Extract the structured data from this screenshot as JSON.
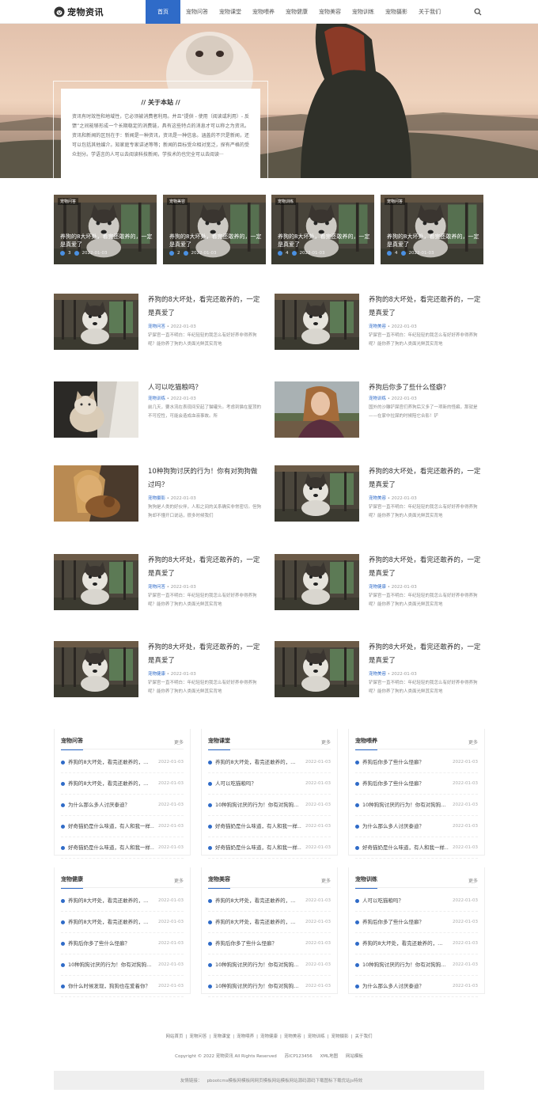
{
  "header": {
    "logo_text": "宠物资讯",
    "nav": [
      "首页",
      "宠物问答",
      "宠物课堂",
      "宠物喂养",
      "宠物健康",
      "宠物美容",
      "宠物训练",
      "宠物摄影",
      "关于我们"
    ],
    "active_index": 0
  },
  "hero": {
    "about_title": "// 关于本站 //",
    "about_text": "资讯有时效性和地域性，它必须被消费者利用。并且“提供 - 使用（阅读或利用）- 反馈”之间能够形成一个长期稳定的消费链，具有这些特点的消息才可以称之为资讯。资讯和新闻的区别在于：新闻是一种资讯，资讯是一种信息。涵盖的不只是新闻，还可以包括其他媒介。知家庭专家讲述等等；新闻的目标受众相对宽泛，探有严格的受众划分。学语言的人可以去阅读科技新闻，学技术的也完全可以去阅读···"
  },
  "featured": [
    {
      "tag": "宠物问答",
      "title": "养狗的8大坏处，看完还敢养的，一定是真爱了",
      "views": "3",
      "date": "2022-01-03"
    },
    {
      "tag": "宠物美容",
      "title": "养狗的8大坏处，看完还敢养的，一定是真爱了",
      "views": "2",
      "date": "2022-01-03"
    },
    {
      "tag": "宠物训练",
      "title": "养狗的8大坏处，看完还敢养的，一定是真爱了",
      "views": "4",
      "date": "2022-01-03"
    },
    {
      "tag": "宠物问答",
      "title": "养狗的8大坏处，看完还敢养的，一定是真爱了",
      "views": "4",
      "date": "2022-01-03"
    }
  ],
  "articles": [
    {
      "title": "养狗的8大坏处，看完还敢养的，一定是真爱了",
      "cat": "宠物问答",
      "date": "2022-01-03",
      "excerpt": "铲屎官一直不明白：年纪轻轻的我怎么有好好养非得养狗呢？能你养了狗的人类面光鲜其实背地",
      "img": "husky"
    },
    {
      "title": "养狗的8大坏处，看完还敢养的，一定是真爱了",
      "cat": "宠物美容",
      "date": "2022-01-03",
      "excerpt": "铲屎官一直不明白：年纪轻轻的我怎么有好好养非得养狗呢？能你养了狗的人类面光鲜其实背地",
      "img": "husky"
    },
    {
      "title": "人可以吃猫粮吗？",
      "cat": "宠物训练",
      "date": "2022-01-03",
      "excerpt": "前几天，要水流在表现间安起了猫罐头。考虑到猫在屋顶的不可控性，可能会造成血液事故。所",
      "img": "cat"
    },
    {
      "title": "养狗后你多了些什么怪癖？",
      "cat": "宠物训练",
      "date": "2022-01-03",
      "excerpt": "国外的沙雕铲屎官们养狗后又多了一项新的怪癖，那就是——在家中拉屎的时候陪它合影！铲",
      "img": "woman"
    },
    {
      "title": "10种狗狗讨厌的行为！你有对狗狗做过吗？",
      "cat": "宠物摄影",
      "date": "2022-01-03",
      "excerpt": "狗狗是人类的好伙伴，人和之间的关系确实非常密切。但狗狗却不懂开口说话，很多时候我们",
      "img": "girl"
    },
    {
      "title": "养狗的8大坏处，看完还敢养的，一定是真爱了",
      "cat": "宠物美容",
      "date": "2022-01-03",
      "excerpt": "铲屎官一直不明白：年纪轻轻的我怎么有好好养非得养狗呢？能你养了狗的人类面光鲜其实背地",
      "img": "husky"
    },
    {
      "title": "养狗的8大坏处，看完还敢养的，一定是真爱了",
      "cat": "宠物问答",
      "date": "2022-01-03",
      "excerpt": "铲屎官一直不明白：年纪轻轻的我怎么有好好养非得养狗呢？能你养了狗的人类面光鲜其实背地",
      "img": "husky"
    },
    {
      "title": "养狗的8大坏处，看完还敢养的，一定是真爱了",
      "cat": "宠物健康",
      "date": "2022-01-03",
      "excerpt": "铲屎官一直不明白：年纪轻轻的我怎么有好好养非得养狗呢？能你养了狗的人类面光鲜其实背地",
      "img": "husky"
    },
    {
      "title": "养狗的8大坏处，看完还敢养的，一定是真爱了",
      "cat": "宠物健康",
      "date": "2022-01-03",
      "excerpt": "铲屎官一直不明白：年纪轻轻的我怎么有好好养非得养狗呢？能你养了狗的人类面光鲜其实背地",
      "img": "husky"
    },
    {
      "title": "养狗的8大坏处，看完还敢养的，一定是真爱了",
      "cat": "宠物美容",
      "date": "2022-01-03",
      "excerpt": "铲屎官一直不明白：年纪轻轻的我怎么有好好养非得养狗呢？能你养了狗的人类面光鲜其实背地",
      "img": "husky"
    }
  ],
  "boxes": [
    {
      "title": "宠物问答",
      "more": "更多",
      "items": [
        {
          "t": "养狗的8大坏处，看完还敢养的，...",
          "d": "2022-01-03"
        },
        {
          "t": "养狗的8大坏处，看完还敢养的，...",
          "d": "2022-01-03"
        },
        {
          "t": "为什么那么多人讨厌泰迪？",
          "d": "2022-01-03"
        },
        {
          "t": "好奇猫奶是什么味道，有人和我一样...",
          "d": "2022-01-03"
        },
        {
          "t": "好奇猫奶是什么味道，有人和我一样...",
          "d": "2022-01-03"
        }
      ]
    },
    {
      "title": "宠物课堂",
      "more": "更多",
      "items": [
        {
          "t": "养狗的8大坏处，看完还敢养的，...",
          "d": "2022-01-03"
        },
        {
          "t": "人可以吃猫粮吗？",
          "d": "2022-01-03"
        },
        {
          "t": "10种狗狗讨厌的行为！你有对狗狗...",
          "d": "2022-01-03"
        },
        {
          "t": "好奇猫奶是什么味道，有人和我一样...",
          "d": "2022-01-03"
        },
        {
          "t": "好奇猫奶是什么味道，有人和我一样...",
          "d": "2022-01-03"
        }
      ]
    },
    {
      "title": "宠物喂养",
      "more": "更多",
      "items": [
        {
          "t": "养狗后你多了些什么怪癖？",
          "d": "2022-01-03"
        },
        {
          "t": "养狗后你多了些什么怪癖？",
          "d": "2022-01-03"
        },
        {
          "t": "10种狗狗讨厌的行为！你有对狗狗...",
          "d": "2022-01-03"
        },
        {
          "t": "为什么那么多人讨厌泰迪？",
          "d": "2022-01-03"
        },
        {
          "t": "好奇猫奶是什么味道，有人和我一样...",
          "d": "2022-01-03"
        }
      ]
    },
    {
      "title": "宠物健康",
      "more": "更多",
      "items": [
        {
          "t": "养狗的8大坏处，看完还敢养的，...",
          "d": "2022-01-03"
        },
        {
          "t": "养狗的8大坏处，看完还敢养的，...",
          "d": "2022-01-03"
        },
        {
          "t": "养狗后你多了些什么怪癖？",
          "d": "2022-01-03"
        },
        {
          "t": "10种狗狗讨厌的行为！你有对狗狗...",
          "d": "2022-01-03"
        },
        {
          "t": "你什么时候发现，狗狗也在爱着你？",
          "d": "2022-01-03"
        }
      ]
    },
    {
      "title": "宠物美容",
      "more": "更多",
      "items": [
        {
          "t": "养狗的8大坏处，看完还敢养的，...",
          "d": "2022-01-03"
        },
        {
          "t": "养狗的8大坏处，看完还敢养的，...",
          "d": "2022-01-03"
        },
        {
          "t": "养狗后你多了些什么怪癖？",
          "d": "2022-01-03"
        },
        {
          "t": "10种狗狗讨厌的行为！你有对狗狗...",
          "d": "2022-01-03"
        },
        {
          "t": "10种狗狗讨厌的行为！你有对狗狗...",
          "d": "2022-01-03"
        }
      ]
    },
    {
      "title": "宠物训练",
      "more": "更多",
      "items": [
        {
          "t": "人可以吃猫粮吗？",
          "d": "2022-01-03"
        },
        {
          "t": "养狗后你多了些什么怪癖？",
          "d": "2022-01-03"
        },
        {
          "t": "养狗的8大坏处，看完还敢养的，...",
          "d": "2022-01-03"
        },
        {
          "t": "10种狗狗讨厌的行为！你有对狗狗...",
          "d": "2022-01-03"
        },
        {
          "t": "为什么那么多人讨厌泰迪？",
          "d": "2022-01-03"
        }
      ]
    }
  ],
  "footer": {
    "nav": [
      "网站首页",
      "宠物问答",
      "宠物课堂",
      "宠物喂养",
      "宠物健康",
      "宠物美容",
      "宠物训练",
      "宠物摄影",
      "关于我们"
    ],
    "copyright": "Copyright © 2022 宠物资讯 All Rights Reserved",
    "icp": "苏ICP123456",
    "xml": "XML地图",
    "tpl": "网站模板",
    "links_label": "友情链接：",
    "links": [
      "pbootcms模板网",
      "模板网",
      "网页模板",
      "网站模板",
      "网站源码",
      "源码下载",
      "图标下载",
      "优站",
      "js特效"
    ]
  },
  "colors": {
    "accent": "#2f6bc8"
  }
}
